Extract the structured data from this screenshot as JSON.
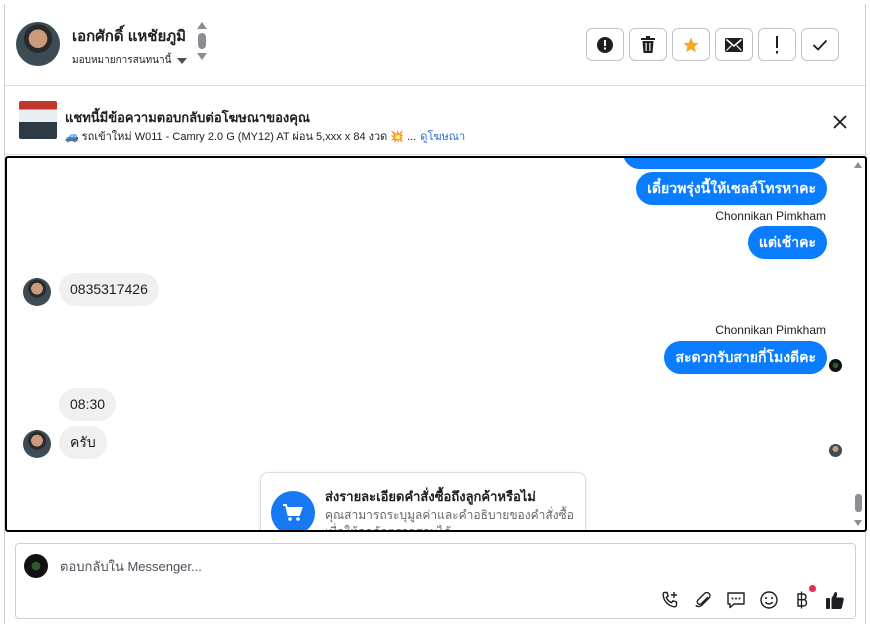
{
  "header": {
    "contact_name": "เอกศักดิ์ แหชัยภูมิ",
    "assign_label": "มอบหมายการสนทนานี้",
    "actions": [
      {
        "icon": "alert-circle-icon",
        "label": "spam"
      },
      {
        "icon": "trash-icon",
        "label": "delete"
      },
      {
        "icon": "star-icon",
        "label": "follow up"
      },
      {
        "icon": "envelope-icon",
        "label": "mark unread"
      },
      {
        "icon": "exclamation-icon",
        "label": "important"
      },
      {
        "icon": "check-icon",
        "label": "done"
      }
    ],
    "star_color": "#f5a623"
  },
  "ad": {
    "title": "แชทนี้มีข้อความตอบกลับต่อโฆษณาของคุณ",
    "subtitle": "🚙 รถเข้าใหม่ W011 - Camry 2.0 G (MY12) AT ผ่อน 5,xxx x 84 งวด 💥 ...",
    "link": "ดูโฆษณา"
  },
  "conversation": {
    "messages": [
      {
        "direction": "out",
        "text": "เดี๋ยวพรุ่งนี้ให้เซลล์โทรหาคะ"
      },
      {
        "direction": "out",
        "sender": "Chonnikan Pimkham",
        "text": "แต่เช้าคะ"
      },
      {
        "direction": "in",
        "text": "0835317426"
      },
      {
        "direction": "out",
        "sender": "Chonnikan Pimkham",
        "text": "สะดวกรับสายกี่โมงดีคะ"
      },
      {
        "direction": "in",
        "text": "08:30"
      },
      {
        "direction": "in",
        "text": "ครับ"
      }
    ],
    "card": {
      "title": "ส่งรายละเอียดคำสั่งซื้อถึงลูกค้าหรือไม่",
      "description": "คุณสามารถระบุมูลค่าและคำอธิบายของคำสั่งซื้อ เพื่อให้ลูกค้าตรวจสอบได้",
      "icon": "cart-icon"
    },
    "outgoing_color": "#0a7cff",
    "incoming_color": "#f0f0f0"
  },
  "composer": {
    "placeholder": "ตอบกลับใน Messenger...",
    "tools": [
      "phone-add-icon",
      "paperclip-icon",
      "saved-reply-icon",
      "emoji-icon",
      "baht-icon",
      "thumbs-up-icon"
    ]
  }
}
